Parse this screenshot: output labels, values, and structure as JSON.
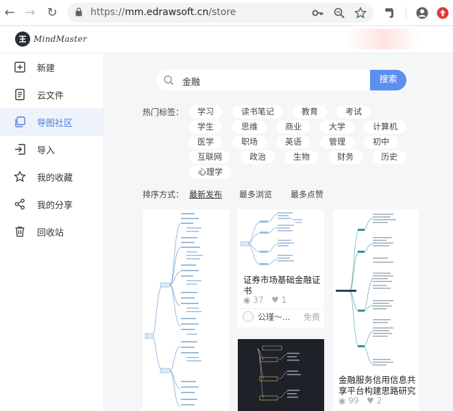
{
  "browser": {
    "url_scheme": "https://",
    "url_host": "mm.edrawsoft.cn",
    "url_path": "/store"
  },
  "app": {
    "logo_text": "MindMaster"
  },
  "sidebar": {
    "items": [
      {
        "label": "新建",
        "icon": "plus-square-icon"
      },
      {
        "label": "云文件",
        "icon": "document-icon"
      },
      {
        "label": "导图社区",
        "icon": "copy-icon",
        "active": true
      },
      {
        "label": "导入",
        "icon": "import-icon"
      },
      {
        "label": "我的收藏",
        "icon": "star-icon"
      },
      {
        "label": "我的分享",
        "icon": "share-icon"
      },
      {
        "label": "回收站",
        "icon": "trash-icon"
      }
    ]
  },
  "search": {
    "value": "金融",
    "button_label": "搜索"
  },
  "tags": {
    "label": "热门标签：",
    "items": [
      "学习",
      "读书笔记",
      "教育",
      "考试",
      "学生",
      "思维",
      "商业",
      "大学",
      "计算机",
      "医学",
      "职场",
      "英语",
      "管理",
      "初中",
      "互联网",
      "政治",
      "生物",
      "财务",
      "历史",
      "心理学"
    ]
  },
  "sort": {
    "label": "排序方式：",
    "options": [
      "最新发布",
      "最多浏览",
      "最多点赞"
    ],
    "active": "最新发布"
  },
  "cards": [
    {
      "title_line1": "证券市场基础金融证",
      "title_line2": "书",
      "views": "37",
      "likes": "1",
      "author": "公瑾～...",
      "price": "免费"
    },
    {
      "title_line1": "金融服务信用信息共",
      "title_line2": "享平台构建思路研究",
      "views": "99",
      "likes": "2"
    }
  ],
  "colors": {
    "accent": "#5b8ff0",
    "sidebar_active_bg": "#eef2fb",
    "main_bg": "#f5f6f8"
  }
}
